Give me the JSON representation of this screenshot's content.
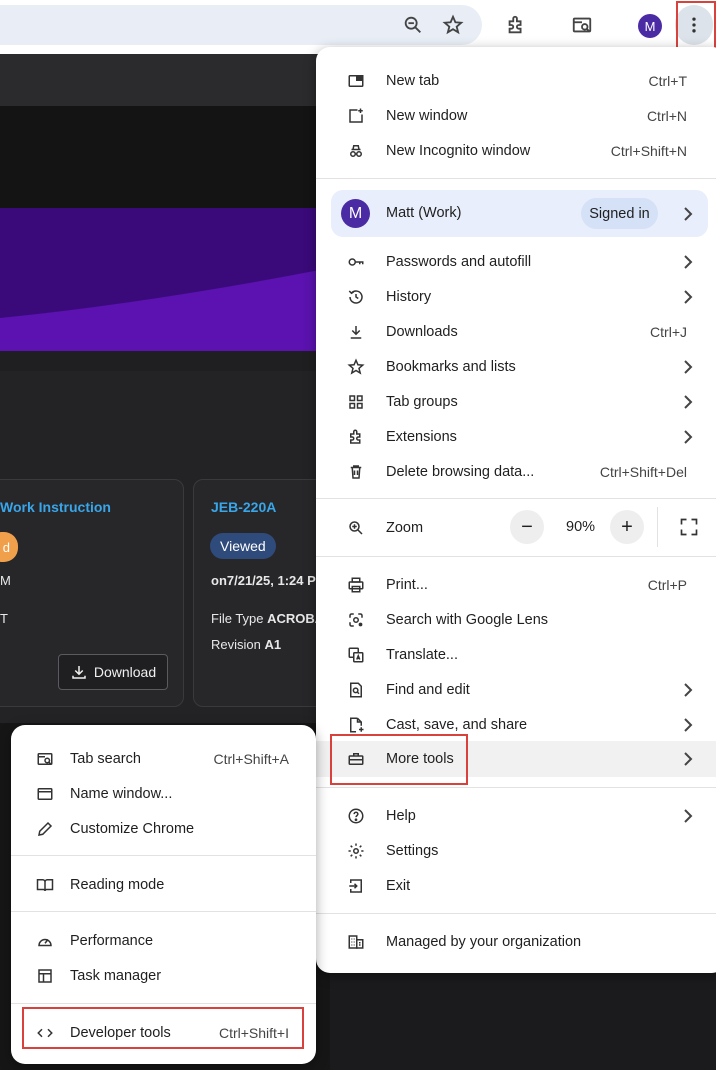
{
  "toolbar": {
    "avatar_letter": "M",
    "icons": [
      "zoom-icon",
      "bookmark-star-icon",
      "extensions-icon",
      "tab-search-icon",
      "avatar",
      "kebab-menu-icon"
    ]
  },
  "page": {
    "card1": {
      "title": "Work Instruction",
      "badge": "d",
      "line1": "M",
      "line2": "T",
      "download": "Download"
    },
    "card2": {
      "title": "JEB-220A",
      "badge": "Viewed",
      "line1": "on7/21/25, 1:24 P",
      "filetype_label": "File Type ",
      "filetype_value": "ACROBA",
      "revision_label": "Revision ",
      "revision_value": "A1"
    }
  },
  "menu": {
    "new_tab": {
      "label": "New tab",
      "shortcut": "Ctrl+T"
    },
    "new_window": {
      "label": "New window",
      "shortcut": "Ctrl+N"
    },
    "incognito": {
      "label": "New Incognito window",
      "shortcut": "Ctrl+Shift+N"
    },
    "profile": {
      "avatar": "M",
      "name": "Matt (Work)",
      "status": "Signed in"
    },
    "passwords": {
      "label": "Passwords and autofill"
    },
    "history": {
      "label": "History"
    },
    "downloads": {
      "label": "Downloads",
      "shortcut": "Ctrl+J"
    },
    "bookmarks": {
      "label": "Bookmarks and lists"
    },
    "tab_groups": {
      "label": "Tab groups"
    },
    "extensions": {
      "label": "Extensions"
    },
    "delete_data": {
      "label": "Delete browsing data...",
      "shortcut": "Ctrl+Shift+Del"
    },
    "zoom": {
      "label": "Zoom",
      "minus": "−",
      "value": "90%",
      "plus": "+"
    },
    "print": {
      "label": "Print...",
      "shortcut": "Ctrl+P"
    },
    "lens": {
      "label": "Search with Google Lens"
    },
    "translate": {
      "label": "Translate..."
    },
    "find_edit": {
      "label": "Find and edit"
    },
    "cast": {
      "label": "Cast, save, and share"
    },
    "more_tools": {
      "label": "More tools"
    },
    "help": {
      "label": "Help"
    },
    "settings": {
      "label": "Settings"
    },
    "exit": {
      "label": "Exit"
    },
    "managed": {
      "label": "Managed by your organization"
    }
  },
  "submenu": {
    "tab_search": {
      "label": "Tab search",
      "shortcut": "Ctrl+Shift+A"
    },
    "name_window": {
      "label": "Name window..."
    },
    "customize": {
      "label": "Customize Chrome"
    },
    "reading_mode": {
      "label": "Reading mode"
    },
    "performance": {
      "label": "Performance"
    },
    "task_manager": {
      "label": "Task manager"
    },
    "dev_tools": {
      "label": "Developer tools",
      "shortcut": "Ctrl+Shift+I"
    }
  },
  "colors": {
    "highlight": "#d9423c",
    "avatar": "#4b2ba3",
    "link": "#38a6ea",
    "badge_viewed": "#2f4b7c"
  }
}
